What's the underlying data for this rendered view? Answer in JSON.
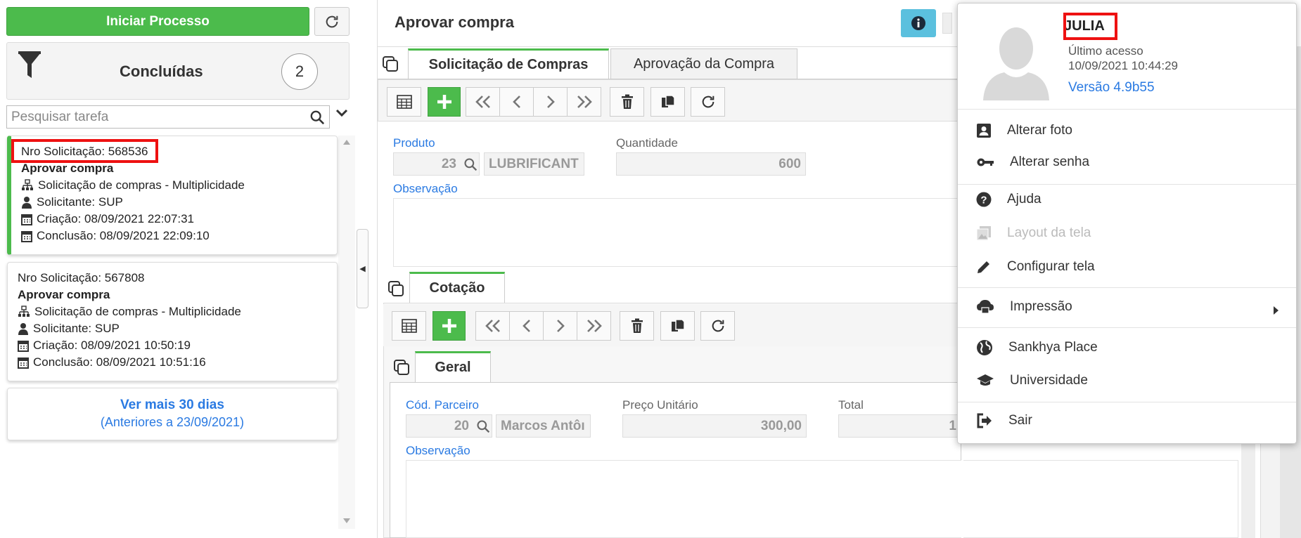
{
  "left_panel": {
    "start_button": "Iniciar Processo",
    "filter_title": "Concluídas",
    "filter_count": "2",
    "search_placeholder": "Pesquisar tarefa",
    "tasks": [
      {
        "request": "Nro Solicitação: 568536",
        "title": "Aprovar compra",
        "process": "Solicitação de compras - Multiplicidade",
        "requester": "Solicitante:  SUP",
        "created": "Criação: 08/09/2021 22:07:31",
        "completed": "Conclusão: 08/09/2021 22:09:10"
      },
      {
        "request": "Nro Solicitação: 567808",
        "title": "Aprovar compra",
        "process": "Solicitação de compras - Multiplicidade",
        "requester": "Solicitante:  SUP",
        "created": "Criação: 08/09/2021 10:50:19",
        "completed": "Conclusão: 08/09/2021 10:51:16"
      }
    ],
    "more_link": "Ver mais 30 dias",
    "more_sub": "(Anteriores a 23/09/2021)"
  },
  "main": {
    "title": "Aprovar compra",
    "tabs": [
      "Solicitação de Compras",
      "Aprovação da Compra"
    ],
    "produto_label": "Produto",
    "produto_code": "23",
    "produto_name": "LUBRIFICANT",
    "quantidade_label": "Quantidade",
    "quantidade_value": "600",
    "observacao_label": "Observação",
    "cotacao_tab": "Cotação",
    "geral_tab": "Geral",
    "parceiro_label": "Cód. Parceiro",
    "parceiro_code": "20",
    "parceiro_name": "Marcos Antôı",
    "preco_label": "Preço Unitário",
    "preco_value": "300,00",
    "total_label": "Total",
    "total_value": "1",
    "observacao2_label": "Observação"
  },
  "user_menu": {
    "user_name": "JULIA",
    "last_access_label": "Último acesso",
    "last_access_value": "10/09/2021 10:44:29",
    "version": "Versão 4.9b55",
    "items": [
      {
        "label": "Alterar foto",
        "icon": "contact-card-icon"
      },
      {
        "label": "Alterar senha",
        "icon": "key-icon"
      },
      {
        "label": "Ajuda",
        "icon": "help-icon"
      },
      {
        "label": "Layout da tela",
        "icon": "photo-library-icon"
      },
      {
        "label": "Configurar tela",
        "icon": "pencil-icon"
      },
      {
        "label": "Impressão",
        "icon": "cloud-print-icon"
      },
      {
        "label": "Sankhya Place",
        "icon": "globe-icon"
      },
      {
        "label": "Universidade",
        "icon": "graduation-cap-icon"
      },
      {
        "label": "Sair",
        "icon": "logout-icon"
      }
    ]
  },
  "colors": {
    "green": "#4cbb4c",
    "blue_link": "#2a7ae2",
    "info": "#5bc0de",
    "highlight": "#e11111"
  }
}
